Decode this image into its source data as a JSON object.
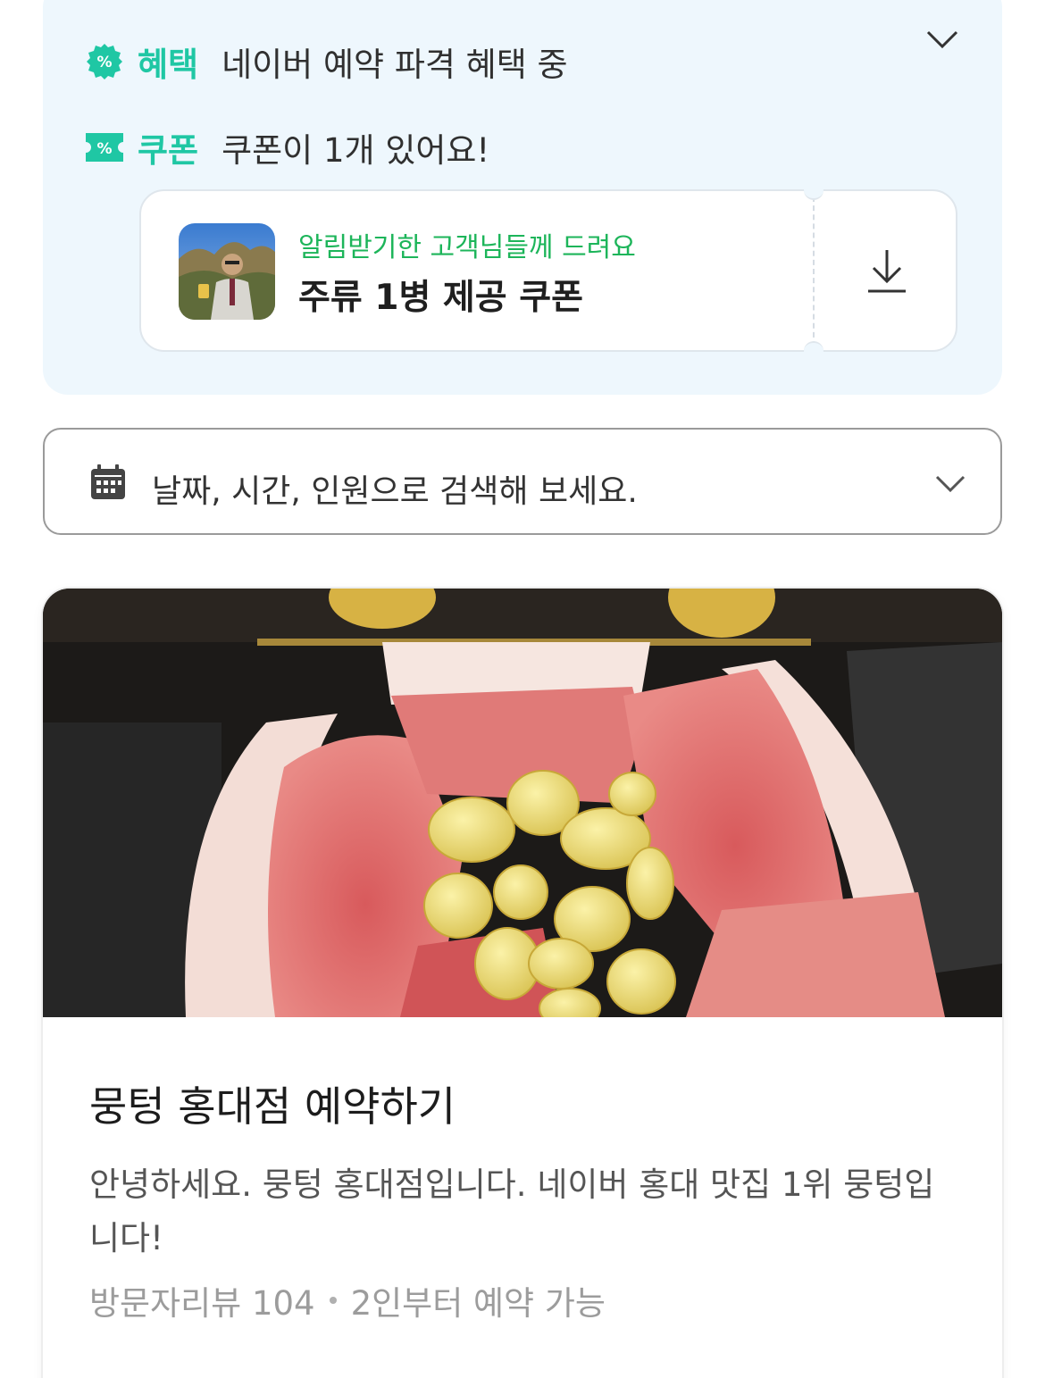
{
  "benefit": {
    "tag": "혜택",
    "text": "네이버 예약 파격 혜택 중"
  },
  "coupon_row": {
    "tag": "쿠폰",
    "text": "쿠폰이 1개 있어요!"
  },
  "coupon_card": {
    "subtitle": "알림받기한 고객님들께 드려요",
    "title": "주류 1병 제공 쿠폰"
  },
  "search": {
    "placeholder": "날짜, 시간, 인원으로 검색해 보세요."
  },
  "card": {
    "title": "뭉텅 홍대점 예약하기",
    "description": "안녕하세요. 뭉텅 홍대점입니다. 네이버 홍대 맛집 1위 뭉텅입니다!",
    "reviews": "방문자리뷰 104",
    "min_people": "2인부터 예약 가능"
  },
  "colors": {
    "accent_mint": "#1fc7a4",
    "accent_green": "#1db55a",
    "panel_bg": "#eef7fd"
  },
  "icons": [
    "percent-badge-icon",
    "percent-ticket-icon",
    "chevron-down-icon",
    "download-icon",
    "calendar-icon"
  ]
}
